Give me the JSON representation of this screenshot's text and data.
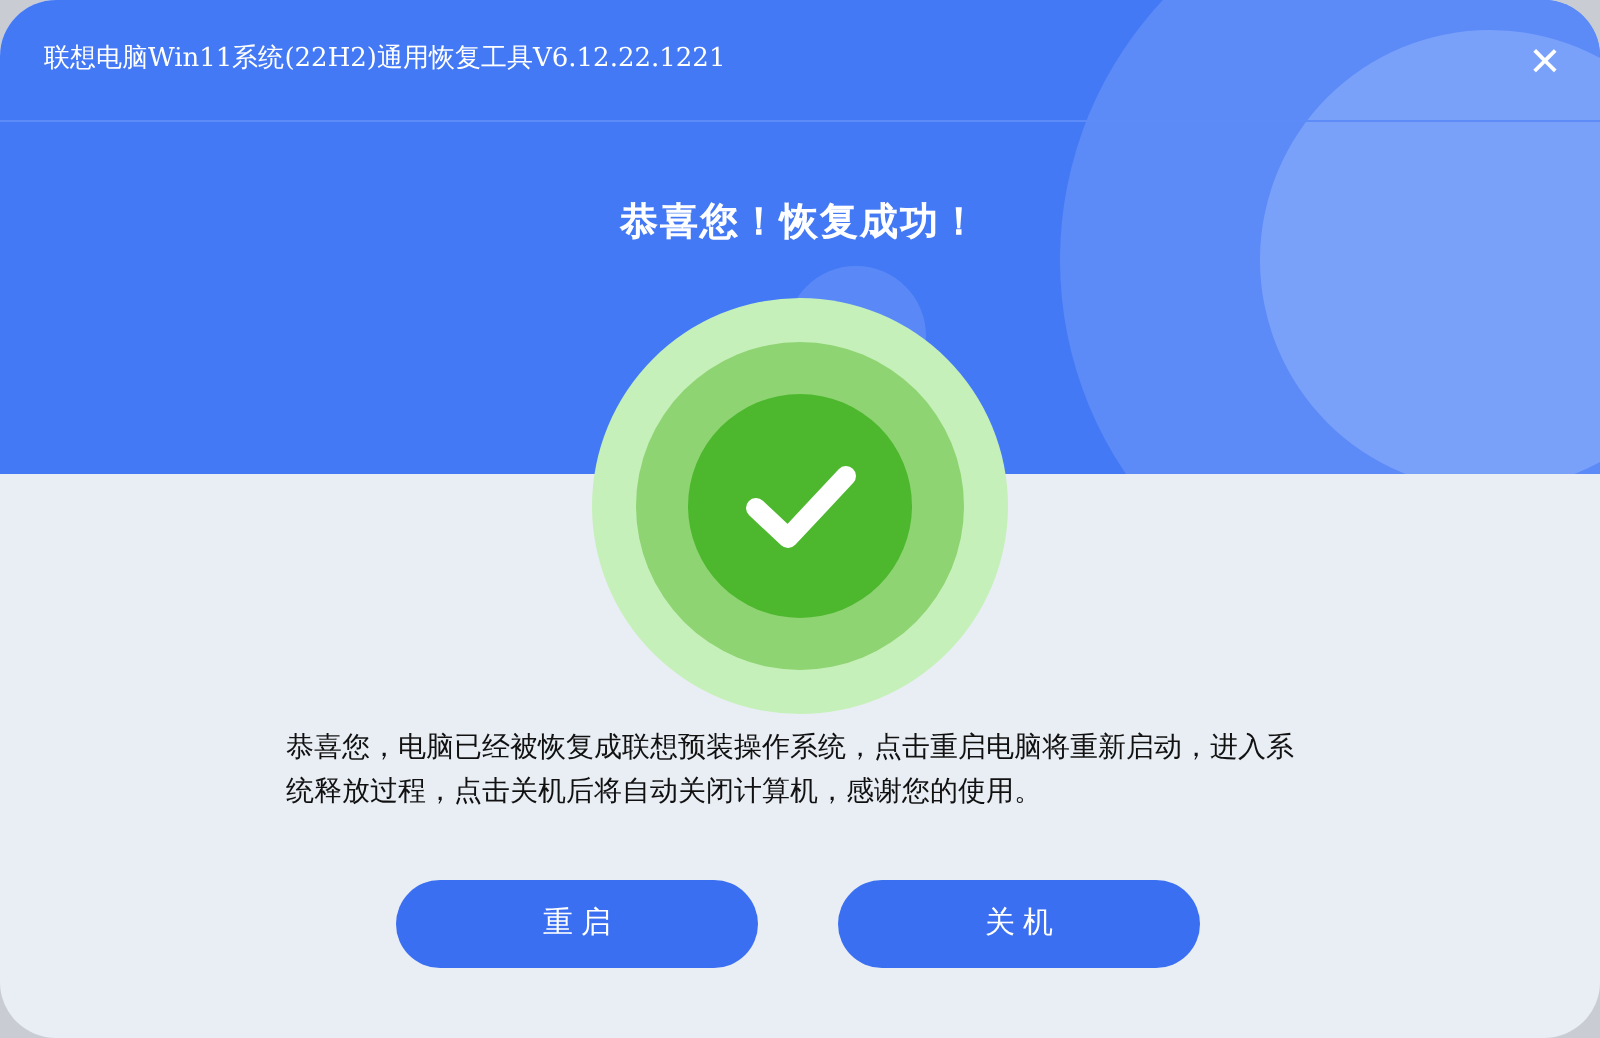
{
  "window": {
    "title": "联想电脑Win11系统(22H2)通用恢复工具V6.12.22.1221",
    "close": "×"
  },
  "headline": "恭喜您！恢复成功！",
  "message": "恭喜您，电脑已经被恢复成联想预装操作系统，点击重启电脑将重新启动，进入系统释放过程，点击关机后将自动关闭计算机，感谢您的使用。",
  "buttons": [
    "重 启",
    "关 机"
  ]
}
